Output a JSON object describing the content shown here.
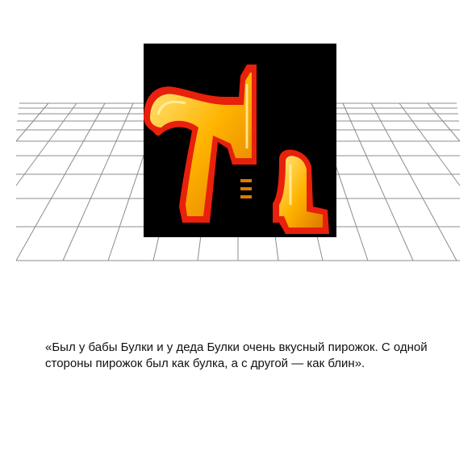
{
  "logo": {
    "icon": "stylized-letters-logo-icon",
    "colors": {
      "background": "#000000",
      "outline": "#e8200c",
      "fill_light": "#ffe066",
      "fill_dark": "#f0a000"
    }
  },
  "floor": {
    "icon": "perspective-grid-icon",
    "line_color": "#8c8c8c"
  },
  "quote": {
    "text": "«Был у бабы Булки и у деда Булки очень вкусный пирожок. С одной стороны пирожок был как булка, а с другой — как блин»."
  }
}
